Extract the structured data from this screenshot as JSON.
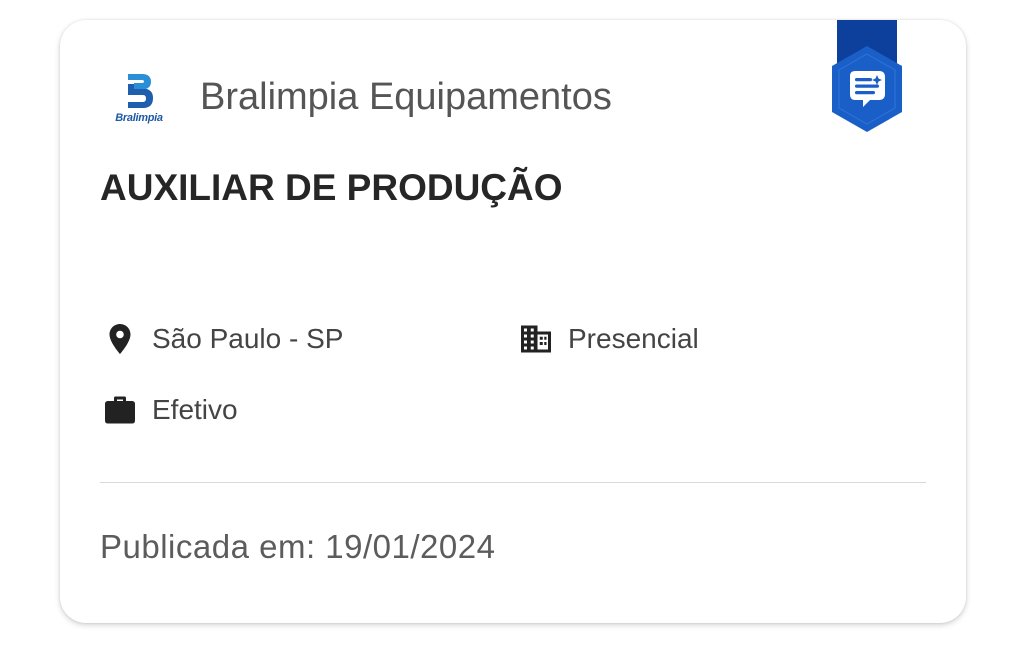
{
  "company": {
    "logo_text": "Bralimpia",
    "logo_icon": "bralimpia-logo-icon",
    "name": "Bralimpia Equipamentos"
  },
  "badge": {
    "icon": "chat-sparkle-icon",
    "color": "#1a5fc8",
    "ribbon_color": "#0d3f9c"
  },
  "job": {
    "title": "AUXILIAR DE PRODUÇÃO",
    "location": "São Paulo - SP",
    "work_mode": "Presencial",
    "contract_type": "Efetivo"
  },
  "published": {
    "text": "Publicada em: 19/01/2024"
  }
}
